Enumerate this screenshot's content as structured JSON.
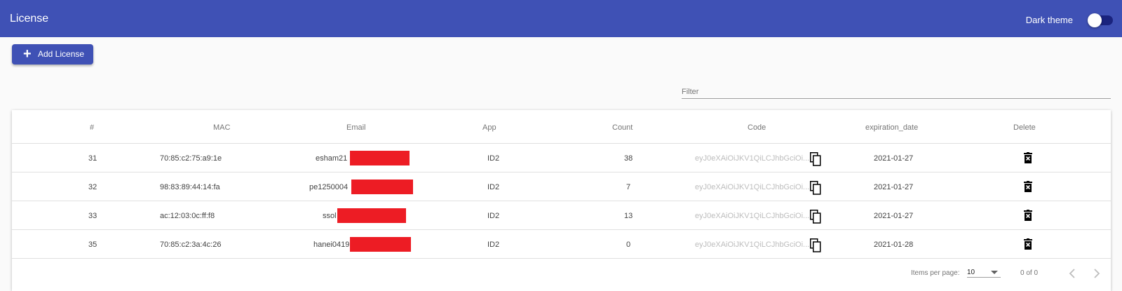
{
  "toolbar": {
    "title": "License",
    "theme_label": "Dark theme"
  },
  "actions": {
    "add_label": "Add License"
  },
  "filter": {
    "placeholder": "Filter"
  },
  "table": {
    "headers": [
      "#",
      "MAC",
      "Email",
      "App",
      "Count",
      "Code",
      "expiration_date",
      "Delete"
    ],
    "rows": [
      {
        "id": "31",
        "mac": "70:85:c2:75:a9:1e",
        "email": "esham21",
        "app": "ID2",
        "count": "38",
        "code": "eyJ0eXAiOiJKV1QiLCJhbGciOi...",
        "expiration": "2021-01-27"
      },
      {
        "id": "32",
        "mac": "98:83:89:44:14:fa",
        "email": "pe1250004",
        "app": "ID2",
        "count": "7",
        "code": "eyJ0eXAiOiJKV1QiLCJhbGciOi...",
        "expiration": "2021-01-27"
      },
      {
        "id": "33",
        "mac": "ac:12:03:0c:ff:f8",
        "email": "ssol",
        "app": "ID2",
        "count": "13",
        "code": "eyJ0eXAiOiJKV1QiLCJhbGciOi...",
        "expiration": "2021-01-27"
      },
      {
        "id": "35",
        "mac": "70:85:c2:3a:4c:26",
        "email": "hanei0419",
        "app": "ID2",
        "count": "0",
        "code": "eyJ0eXAiOiJKV1QiLCJhbGciOi...",
        "expiration": "2021-01-28"
      }
    ]
  },
  "paginator": {
    "items_label": "Items per page:",
    "page_size": "10",
    "range": "0 of 0"
  },
  "icons": {
    "add": "plus-icon",
    "copy": "copy-icon",
    "delete": "delete-icon",
    "prev": "chevron-left-icon",
    "next": "chevron-right-icon"
  },
  "colors": {
    "primary": "#3f51b5",
    "redaction": "#ed1c24"
  }
}
